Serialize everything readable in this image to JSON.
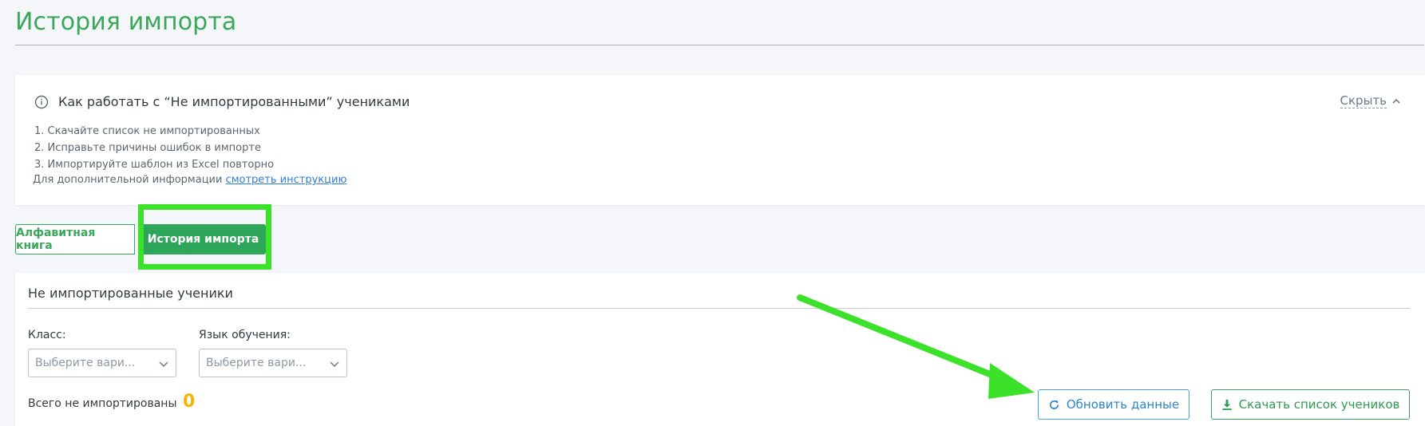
{
  "page": {
    "title": "История импорта"
  },
  "info": {
    "title": "Как работать с “Не импортированными” учениками",
    "hide_label": "Скрыть",
    "steps": [
      "1. Скачайте список не импортированных",
      "2. Исправьте причины ошибок в импорте",
      "3. Импортируйте шаблон из Excel повторно"
    ],
    "more_text": "Для дополнительной информации",
    "more_link": "смотреть инструкцию"
  },
  "tabs": [
    {
      "label": "Алфавитная книга",
      "active": false
    },
    {
      "label": "История импорта",
      "active": true
    }
  ],
  "panel": {
    "title": "Не импортированные ученики",
    "filters": {
      "class_label": "Класс:",
      "class_placeholder": "Выберите вари...",
      "lang_label": "Язык обучения:",
      "lang_placeholder": "Выберите вари..."
    },
    "total_label": "Всего не импортированы",
    "total_count": "0",
    "refresh_label": "Обновить данные",
    "download_label": "Скачать список учеников"
  },
  "icons": {
    "info": "info-circle-icon",
    "hide": "chevron-up-icon",
    "select": "chevron-down-icon",
    "refresh": "refresh-icon",
    "download": "download-icon"
  },
  "colors": {
    "brand_green": "#3aa75a",
    "active_tab": "#2ea65a",
    "highlight": "#3ce12a",
    "count_yellow": "#f2b705",
    "link_blue": "#2f7ed8"
  }
}
